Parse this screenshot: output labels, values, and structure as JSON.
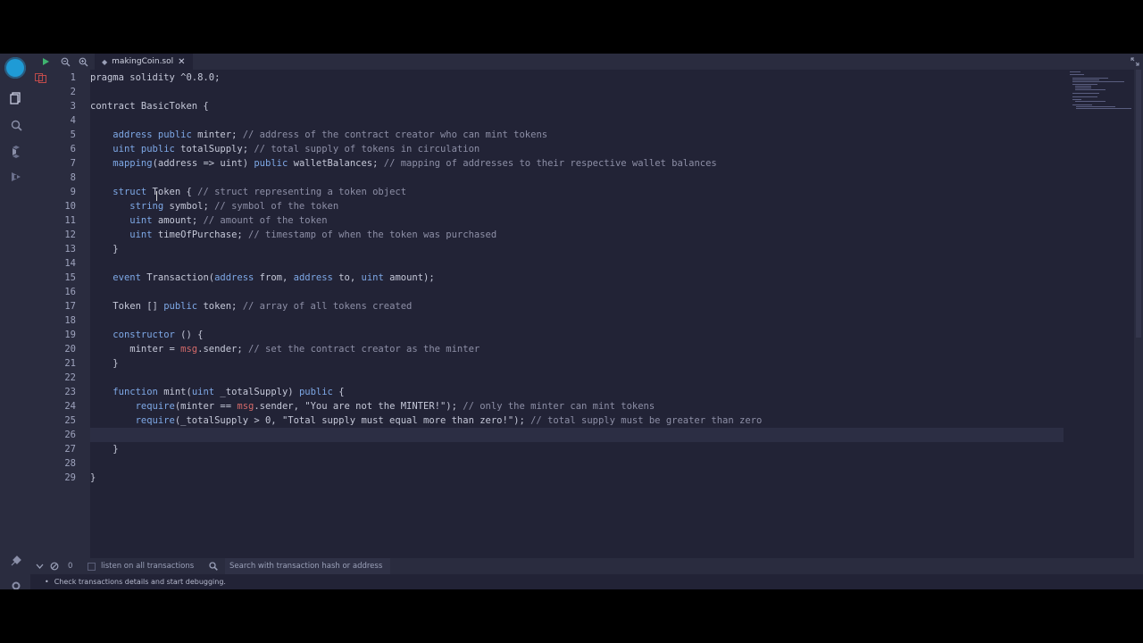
{
  "tab": {
    "filename": "makingCoin.sol"
  },
  "editor": {
    "lines": [
      [
        {
          "t": "pragma solidity ^0.8.0;",
          "c": ""
        }
      ],
      [],
      [
        {
          "t": "contract BasicToken {",
          "c": ""
        }
      ],
      [],
      [
        {
          "t": "    ",
          "c": ""
        },
        {
          "t": "address public",
          "c": "kw"
        },
        {
          "t": " minter; ",
          "c": ""
        },
        {
          "t": "// address of the contract creator who can mint tokens",
          "c": "cm"
        }
      ],
      [
        {
          "t": "    ",
          "c": ""
        },
        {
          "t": "uint public",
          "c": "kw"
        },
        {
          "t": " totalSupply; ",
          "c": ""
        },
        {
          "t": "// total supply of tokens in circulation",
          "c": "cm"
        }
      ],
      [
        {
          "t": "    ",
          "c": ""
        },
        {
          "t": "mapping",
          "c": "kw"
        },
        {
          "t": "(address => uint) ",
          "c": ""
        },
        {
          "t": "public",
          "c": "kw"
        },
        {
          "t": " walletBalances; ",
          "c": ""
        },
        {
          "t": "// mapping of addresses to their respective wallet balances",
          "c": "cm"
        }
      ],
      [],
      [
        {
          "t": "    ",
          "c": ""
        },
        {
          "t": "struct",
          "c": "kw"
        },
        {
          "t": " Token { ",
          "c": ""
        },
        {
          "t": "// struct representing a token object",
          "c": "cm"
        }
      ],
      [
        {
          "t": "       ",
          "c": ""
        },
        {
          "t": "string",
          "c": "kw"
        },
        {
          "t": " symbol; ",
          "c": ""
        },
        {
          "t": "// symbol of the token",
          "c": "cm"
        }
      ],
      [
        {
          "t": "       ",
          "c": ""
        },
        {
          "t": "uint",
          "c": "kw"
        },
        {
          "t": " amount; ",
          "c": ""
        },
        {
          "t": "// amount of the token",
          "c": "cm"
        }
      ],
      [
        {
          "t": "       ",
          "c": ""
        },
        {
          "t": "uint",
          "c": "kw"
        },
        {
          "t": " timeOfPurchase; ",
          "c": ""
        },
        {
          "t": "// timestamp of when the token was purchased",
          "c": "cm"
        }
      ],
      [
        {
          "t": "    }",
          "c": ""
        }
      ],
      [],
      [
        {
          "t": "    ",
          "c": ""
        },
        {
          "t": "event",
          "c": "kw"
        },
        {
          "t": " Transaction(",
          "c": ""
        },
        {
          "t": "address",
          "c": "kw"
        },
        {
          "t": " from, ",
          "c": ""
        },
        {
          "t": "address",
          "c": "kw"
        },
        {
          "t": " to, ",
          "c": ""
        },
        {
          "t": "uint",
          "c": "kw"
        },
        {
          "t": " amount);",
          "c": ""
        }
      ],
      [],
      [
        {
          "t": "    Token [] ",
          "c": ""
        },
        {
          "t": "public",
          "c": "kw"
        },
        {
          "t": " token; ",
          "c": ""
        },
        {
          "t": "// array of all tokens created",
          "c": "cm"
        }
      ],
      [],
      [
        {
          "t": "    ",
          "c": ""
        },
        {
          "t": "constructor",
          "c": "kw"
        },
        {
          "t": " () {",
          "c": ""
        }
      ],
      [
        {
          "t": "       minter = ",
          "c": ""
        },
        {
          "t": "msg",
          "c": "red"
        },
        {
          "t": ".sender; ",
          "c": ""
        },
        {
          "t": "// set the contract creator as the minter",
          "c": "cm"
        }
      ],
      [
        {
          "t": "    }",
          "c": ""
        }
      ],
      [],
      [
        {
          "t": "    ",
          "c": ""
        },
        {
          "t": "function",
          "c": "kw"
        },
        {
          "t": " mint(",
          "c": ""
        },
        {
          "t": "uint",
          "c": "kw"
        },
        {
          "t": " _totalSupply) ",
          "c": ""
        },
        {
          "t": "public",
          "c": "kw"
        },
        {
          "t": " {",
          "c": ""
        }
      ],
      [
        {
          "t": "        ",
          "c": ""
        },
        {
          "t": "require",
          "c": "kw"
        },
        {
          "t": "(minter == ",
          "c": ""
        },
        {
          "t": "msg",
          "c": "red"
        },
        {
          "t": ".sender, \"You are not the MINTER!\"); ",
          "c": ""
        },
        {
          "t": "// only the minter can mint tokens",
          "c": "cm"
        }
      ],
      [
        {
          "t": "        ",
          "c": ""
        },
        {
          "t": "require",
          "c": "kw"
        },
        {
          "t": "(_totalSupply > 0, \"Total supply must equal more than zero!\"); ",
          "c": ""
        },
        {
          "t": "// total supply must be greater than zero",
          "c": "cm"
        }
      ],
      [],
      [
        {
          "t": "    }",
          "c": ""
        }
      ],
      [],
      [
        {
          "t": "}",
          "c": ""
        }
      ]
    ]
  },
  "terminal": {
    "count": "0",
    "listen_label": "listen on all transactions",
    "search_placeholder": "Search with transaction hash or address",
    "message": "Check transactions details and start debugging."
  }
}
